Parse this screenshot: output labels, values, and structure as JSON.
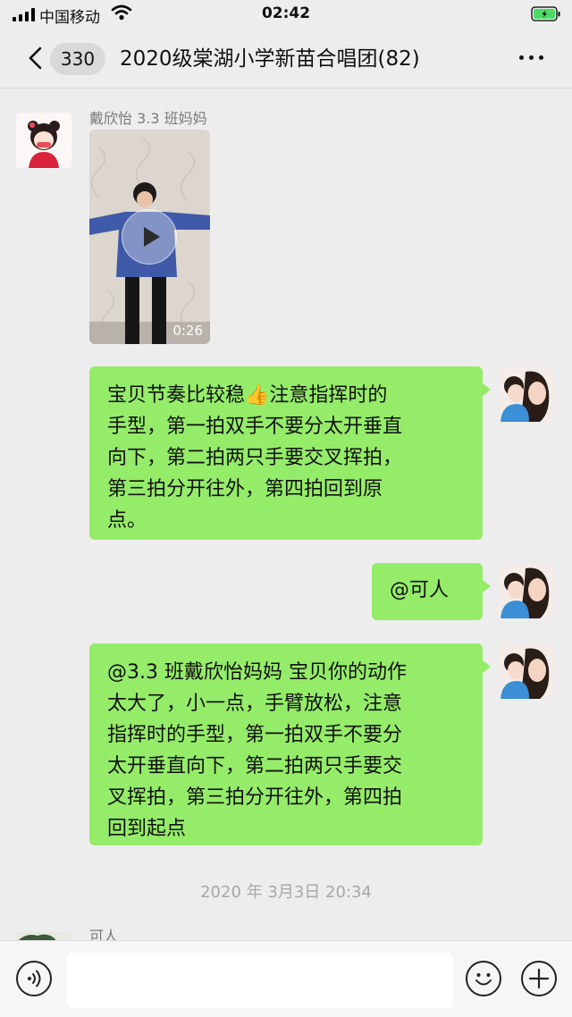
{
  "status_bar": {
    "carrier": "中国移动",
    "time": "02:42"
  },
  "nav": {
    "unread_count": "330",
    "title": "2020级棠湖小学新苗合唱团(82)"
  },
  "messages": [
    {
      "type": "video",
      "sender": "戴欣怡 3.3 班妈妈",
      "duration": "0:26",
      "side": "left"
    },
    {
      "type": "text",
      "side": "right",
      "lines": [
        "宝贝节奏比较稳👍注意指挥时的",
        "手型，第一拍双手不要分太开垂直",
        "向下，第二拍两只手要交叉挥拍，",
        "第三拍分开往外，第四拍回到原",
        "点。"
      ]
    },
    {
      "type": "text",
      "side": "right",
      "lines": [
        "@可人"
      ]
    },
    {
      "type": "text",
      "side": "right",
      "lines": [
        "@3.3 班戴欣怡妈妈 宝贝你的动作",
        "太大了，小一点，手臂放松，注意",
        "指挥时的手型，第一拍双手不要分",
        "太开垂直向下，第二拍两只手要交",
        "叉挥拍，第三拍分开往外，第四拍",
        "回到起点"
      ]
    }
  ],
  "timestamp": "2020 年 3月3日 20:34",
  "partial_sender": "可人",
  "colors": {
    "bubble": "#95ec69",
    "background": "#ededed",
    "battery": "#4cd964"
  },
  "icons": [
    "back-icon",
    "more-icon",
    "voice-icon",
    "emoji-icon",
    "plus-icon",
    "play-icon"
  ]
}
